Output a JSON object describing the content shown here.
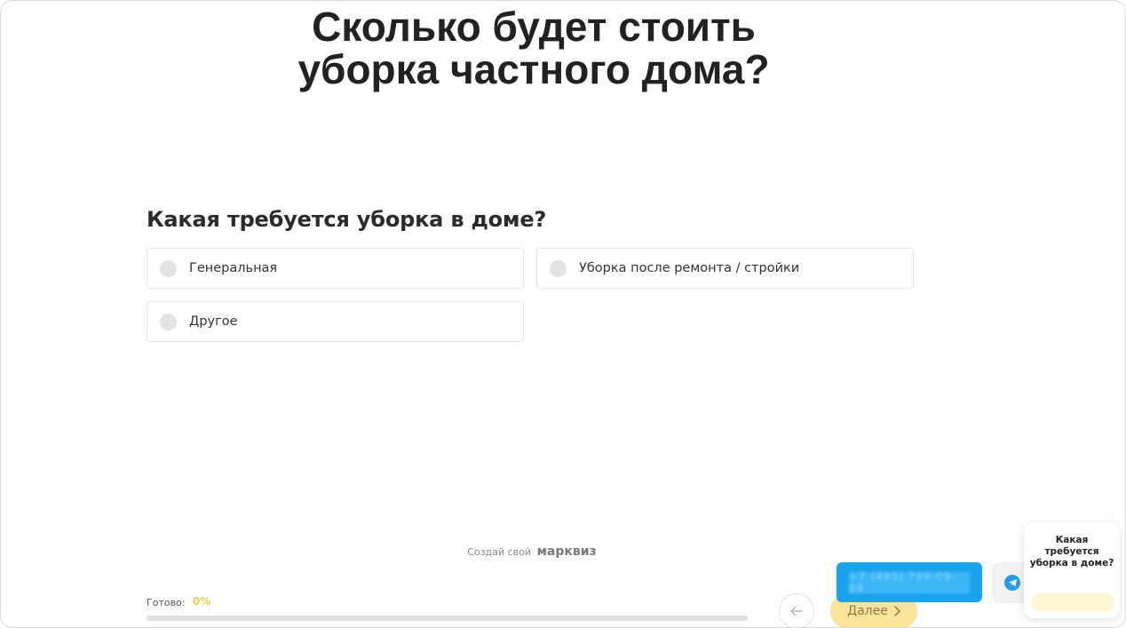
{
  "header": {
    "title_line1": "Сколько будет стоить",
    "title_line2": "уборка частного дома?"
  },
  "quiz": {
    "question": "Какая требуется уборка в доме?",
    "options": [
      {
        "label": "Генеральная",
        "selected": false
      },
      {
        "label": "Уборка после ремонта / стройки",
        "selected": false
      },
      {
        "label": "Другое",
        "selected": false
      }
    ]
  },
  "footer": {
    "credit_prefix": "Создай свой",
    "credit_brand": "марквиз",
    "progress_label": "Готово:",
    "progress_value": "0%",
    "progress_fraction": 0,
    "back_icon": "arrow-left-icon",
    "next_label": "Далее",
    "next_icon": "chevron-right-icon"
  },
  "widgets": {
    "phone_text": "+7 (495) 799-09-09",
    "messenger_icon": "telegram-icon",
    "mini_card_text": "Какая требуется уборка в доме?"
  },
  "colors": {
    "accent": "#f2c94c",
    "phone_button": "#1aa3ee",
    "telegram": "#2a9de2"
  }
}
